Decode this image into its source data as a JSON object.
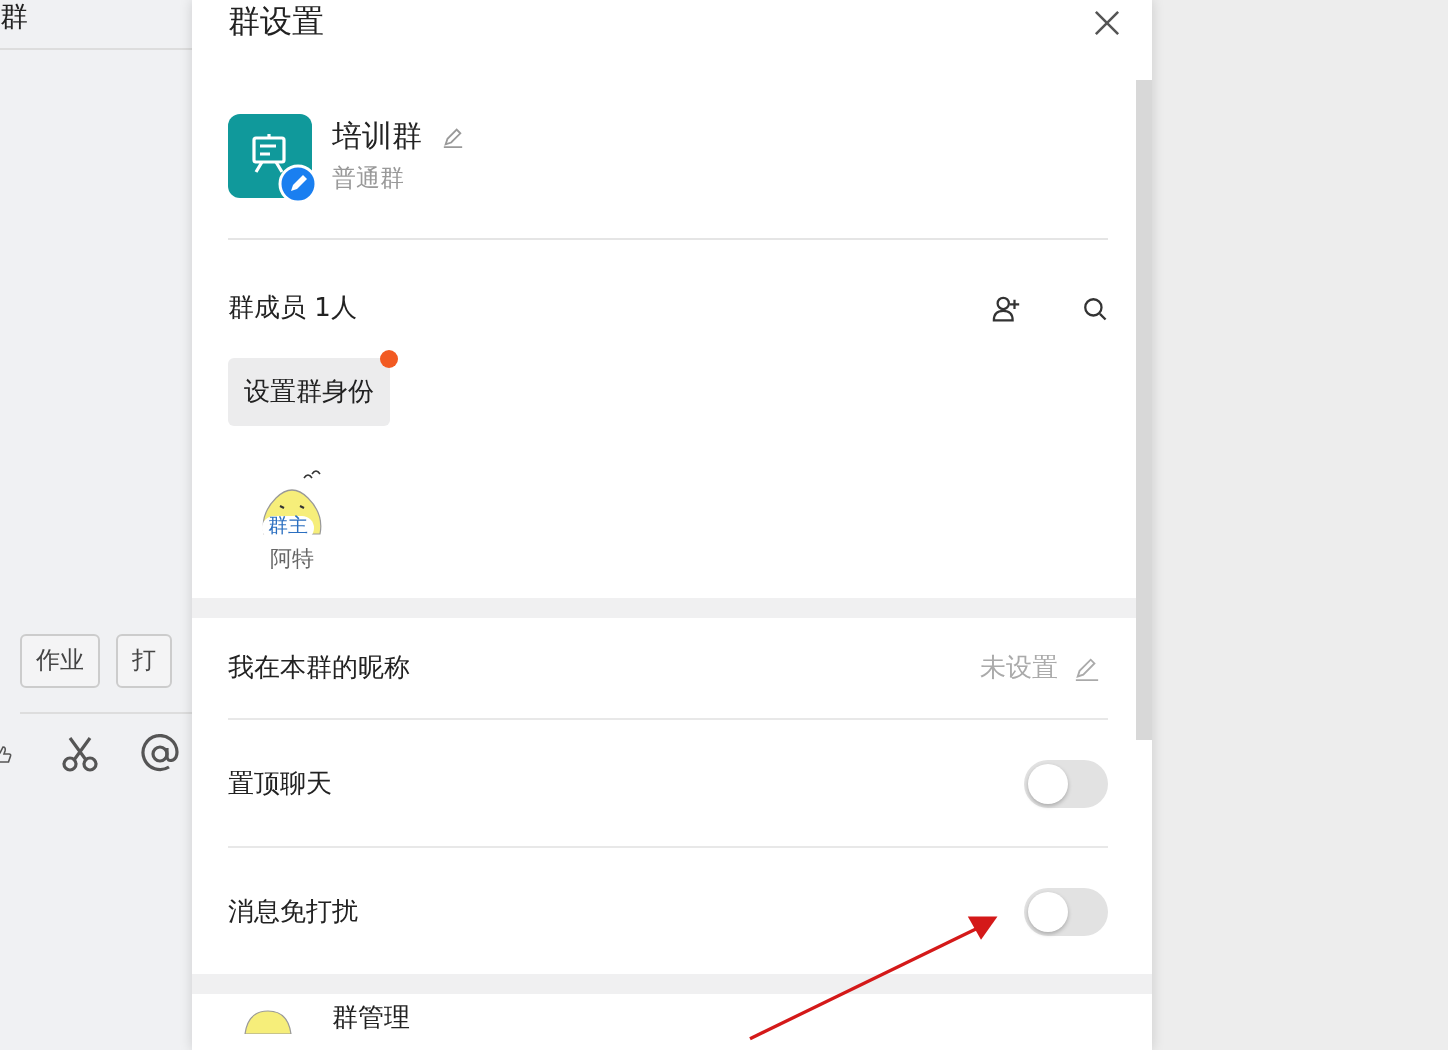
{
  "chat": {
    "title": "群",
    "tabs": [
      "作业",
      "打"
    ]
  },
  "panel": {
    "title": "群设置",
    "group": {
      "name": "培训群",
      "type": "普通群"
    },
    "members": {
      "label": "群成员 1人",
      "role_button": "设置群身份",
      "role_button_dot": true,
      "list": [
        {
          "role": "群主",
          "name": "阿特"
        }
      ]
    },
    "settings": [
      {
        "kind": "value",
        "label": "我在本群的昵称",
        "value": "未设置"
      },
      {
        "kind": "toggle",
        "label": "置顶聊天",
        "on": false
      },
      {
        "kind": "toggle",
        "label": "消息免打扰",
        "on": false
      }
    ],
    "sections": [
      {
        "label": "群管理"
      }
    ]
  }
}
